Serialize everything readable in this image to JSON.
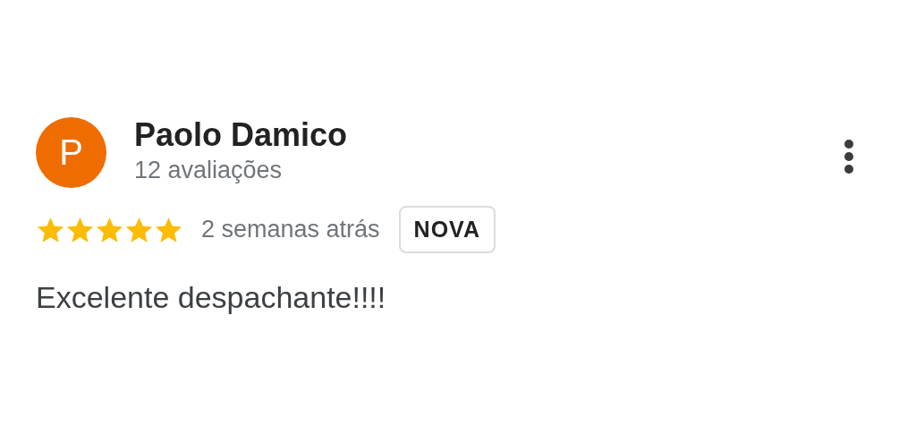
{
  "review": {
    "avatar": {
      "letter": "P",
      "color": "#ef6c00"
    },
    "author": "Paolo Damico",
    "review_count": "12 avaliações",
    "stars": 5,
    "time": "2 semanas atrás",
    "badge": "NOVA",
    "text": "Excelente despachante!!!!"
  }
}
